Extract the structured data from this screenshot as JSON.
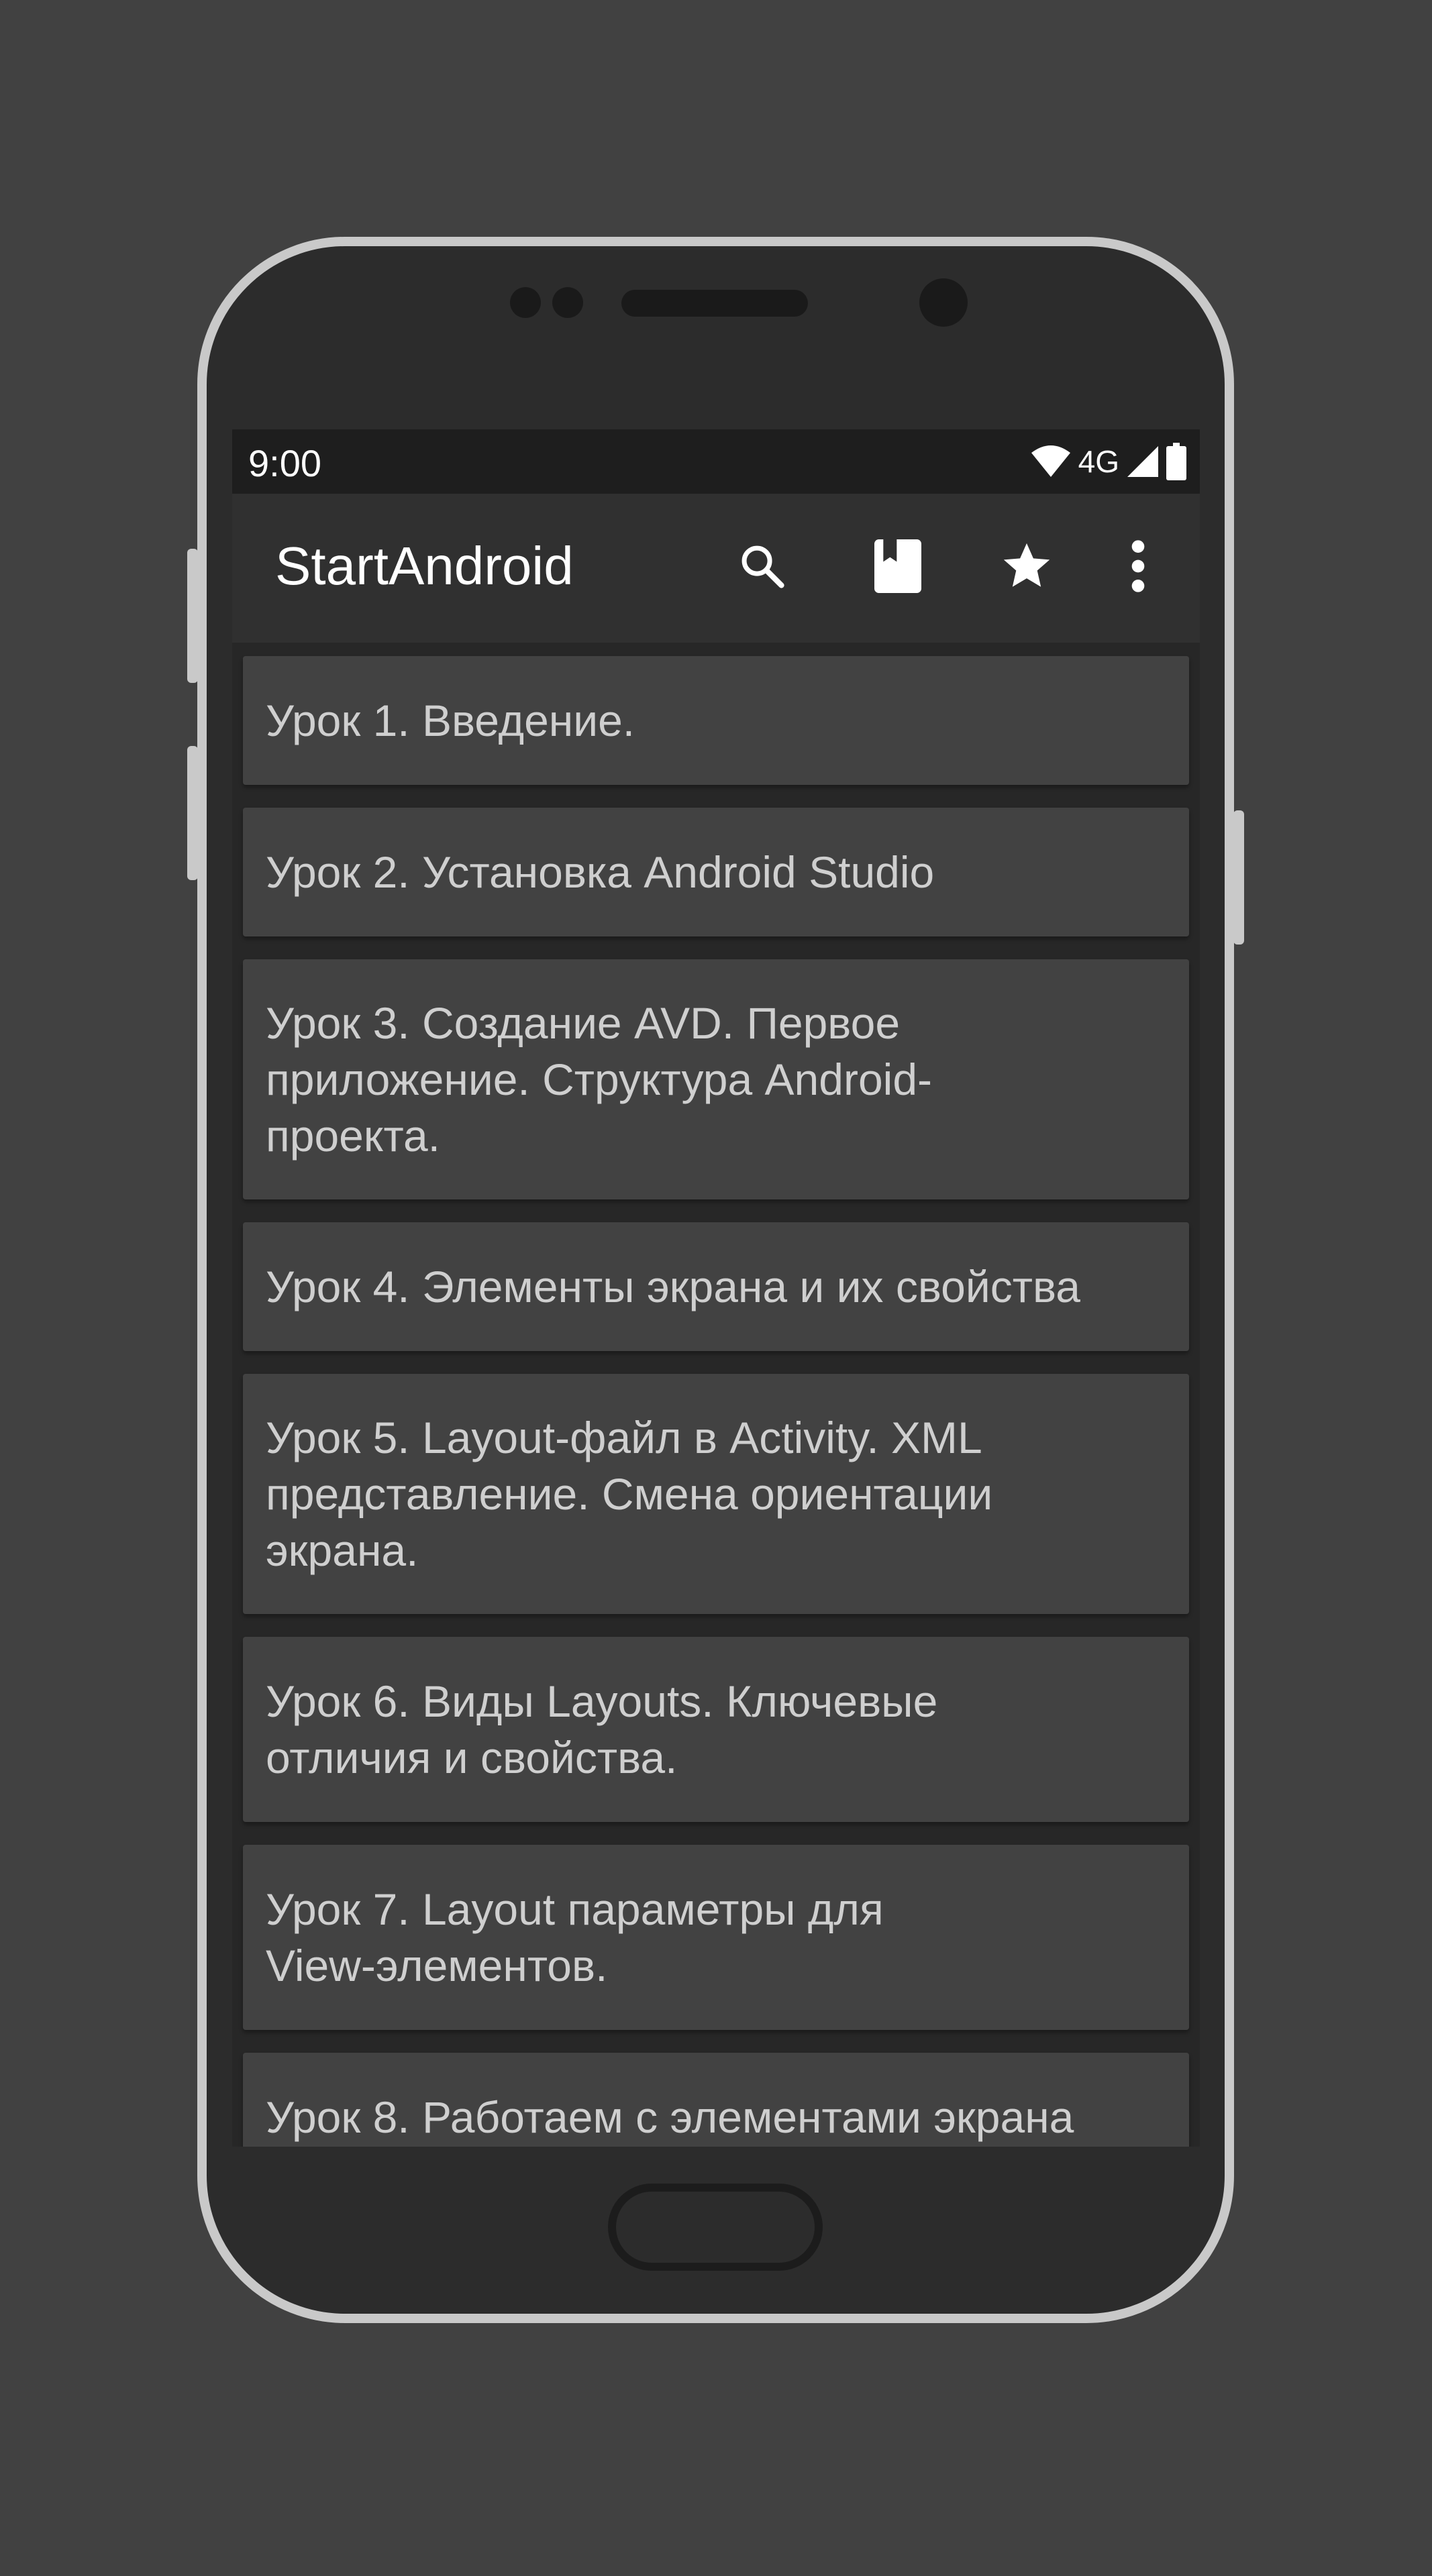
{
  "status_bar": {
    "time": "9:00",
    "network": "4G",
    "icons": [
      "wifi-icon",
      "signal-icon",
      "battery-icon"
    ]
  },
  "toolbar": {
    "title": "StartAndroid",
    "actions": [
      "search-icon",
      "bookmark-icon",
      "star-icon",
      "more-vert-icon"
    ]
  },
  "lessons": [
    "Урок 1. Введение.",
    "Урок 2. Установка Android Studio",
    "Урок 3. Создание AVD. Первое приложение. Структура Android-проекта.",
    "Урок 4. Элементы экрана и их свойства",
    "Урок 5. Layout-файл в Activity. XML представление. Смена ориентации экрана.",
    "Урок 6. Виды Layouts. Ключевые отличия и свойства.",
    "Урок 7. Layout параметры для View-элементов.",
    "Урок 8. Работаем с элементами экрана"
  ],
  "colors": {
    "background": "#414141",
    "screen": "#272727",
    "toolbar": "#303030",
    "card": "#424242",
    "card_text": "#cfcfcf"
  }
}
